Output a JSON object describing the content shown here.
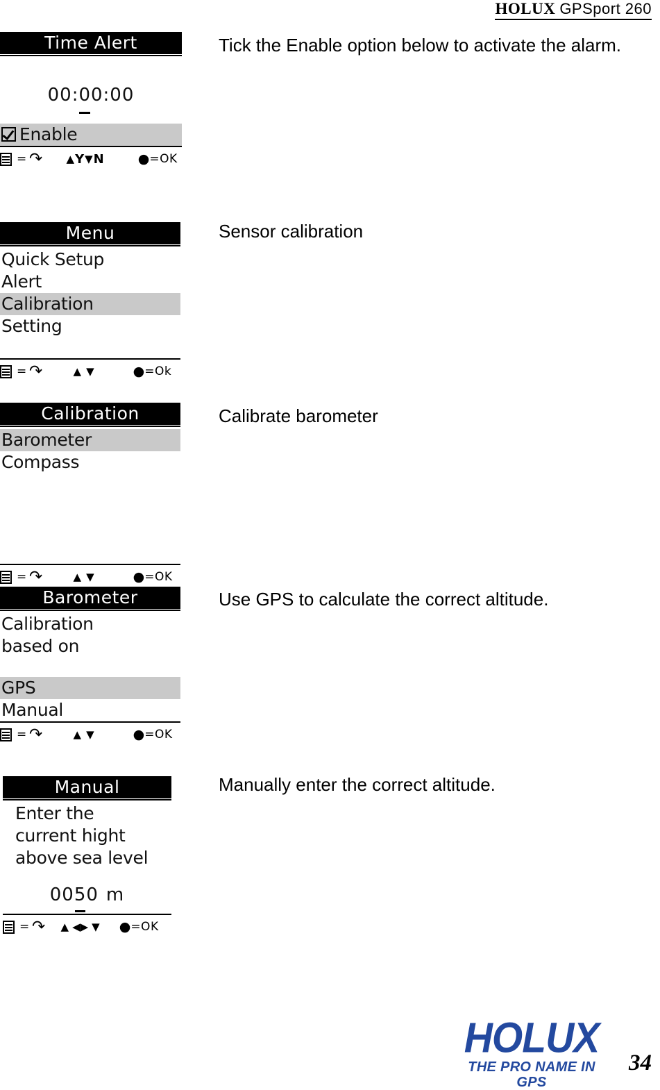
{
  "header": {
    "brand": "HOLUX",
    "model": "GPSport  260"
  },
  "screens": [
    {
      "title": "Time Alert",
      "time_value": "00:00:00",
      "enable_label": "Enable",
      "footbar": {
        "menu_icon": "menu-list-icon",
        "equals": "=",
        "back_icon": "back-arrow-icon",
        "up_icon": "triangle-up-icon",
        "yes_label": "Y",
        "down_icon": "triangle-down-icon",
        "no_label": "N",
        "ok_icon": "filled-circle-icon",
        "ok_label": "=OK"
      }
    },
    {
      "title": "Menu",
      "items": [
        {
          "label": "Quick Setup",
          "selected": false
        },
        {
          "label": "Alert",
          "selected": false
        },
        {
          "label": "Calibration",
          "selected": true
        },
        {
          "label": "Setting",
          "selected": false
        }
      ],
      "footbar": {
        "menu_icon": "menu-list-icon",
        "equals": "=",
        "back_icon": "back-arrow-icon",
        "up_icon": "triangle-up-icon",
        "down_icon": "triangle-down-icon",
        "ok_icon": "filled-circle-icon",
        "ok_label": "=Ok"
      }
    },
    {
      "title": "Calibration",
      "items": [
        {
          "label": "Barometer",
          "selected": true
        },
        {
          "label": "Compass",
          "selected": false
        }
      ],
      "footbar": {
        "menu_icon": "menu-list-icon",
        "equals": "=",
        "back_icon": "back-arrow-icon",
        "up_icon": "triangle-up-icon",
        "down_icon": "triangle-down-icon",
        "ok_icon": "filled-circle-icon",
        "ok_label": "=OK"
      }
    },
    {
      "title": "Barometer",
      "prompt_line1": "Calibration",
      "prompt_line2": "based on",
      "items": [
        {
          "label": "GPS",
          "selected": true
        },
        {
          "label": "Manual",
          "selected": false
        }
      ],
      "footbar": {
        "menu_icon": "menu-list-icon",
        "equals": "=",
        "back_icon": "back-arrow-icon",
        "up_icon": "triangle-up-icon",
        "down_icon": "triangle-down-icon",
        "ok_icon": "filled-circle-icon",
        "ok_label": "=OK"
      }
    },
    {
      "title": "Manual",
      "prompt_line1": "Enter the",
      "prompt_line2": "current hight",
      "prompt_line3": "above sea level",
      "value_prefix": "00",
      "value_cursor_digit": "5",
      "value_suffix": "0",
      "value_unit": "m",
      "footbar": {
        "menu_icon": "menu-list-icon",
        "equals": "=",
        "back_icon": "back-arrow-icon",
        "up_icon": "triangle-up-icon",
        "left_icon": "triangle-left-icon",
        "right_icon": "triangle-right-icon",
        "down_icon": "triangle-down-icon",
        "ok_icon": "filled-circle-icon",
        "ok_label": "=OK"
      }
    }
  ],
  "descriptions": [
    "Tick the Enable option below to activate the alarm.",
    "Sensor calibration",
    "Calibrate barometer",
    "Use GPS to calculate the correct altitude.",
    "Manually enter the correct altitude."
  ],
  "footer": {
    "logo_word": "HOLUX",
    "logo_tagline": "THE PRO NAME IN GPS",
    "logo_color": "#23499f",
    "page_number": "34"
  }
}
